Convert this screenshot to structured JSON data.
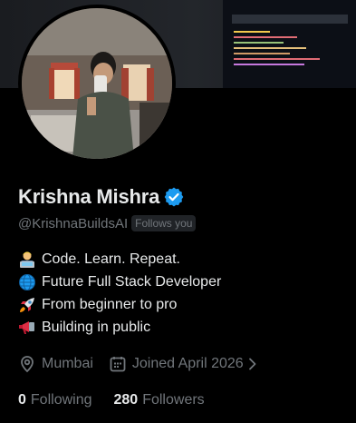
{
  "profile": {
    "name": "Krishna Mishra",
    "handle": "@KrishnaBuildsAI",
    "follows_you_label": "Follows you",
    "verified_icon": "verified-badge-icon",
    "accent_color": "#1d9bf0"
  },
  "bio": [
    {
      "icon": "technologist-emoji",
      "text": "Code. Learn. Repeat."
    },
    {
      "icon": "globe-emoji",
      "text": "Future Full Stack Developer"
    },
    {
      "icon": "rocket-emoji",
      "text": "From beginner to pro"
    },
    {
      "icon": "megaphone-emoji",
      "text": "Building in public"
    }
  ],
  "meta": {
    "location": "Mumbai",
    "joined": "Joined April 2026"
  },
  "stats": {
    "following_count": "0",
    "following_label": "Following",
    "followers_count": "280",
    "followers_label": "Followers"
  }
}
